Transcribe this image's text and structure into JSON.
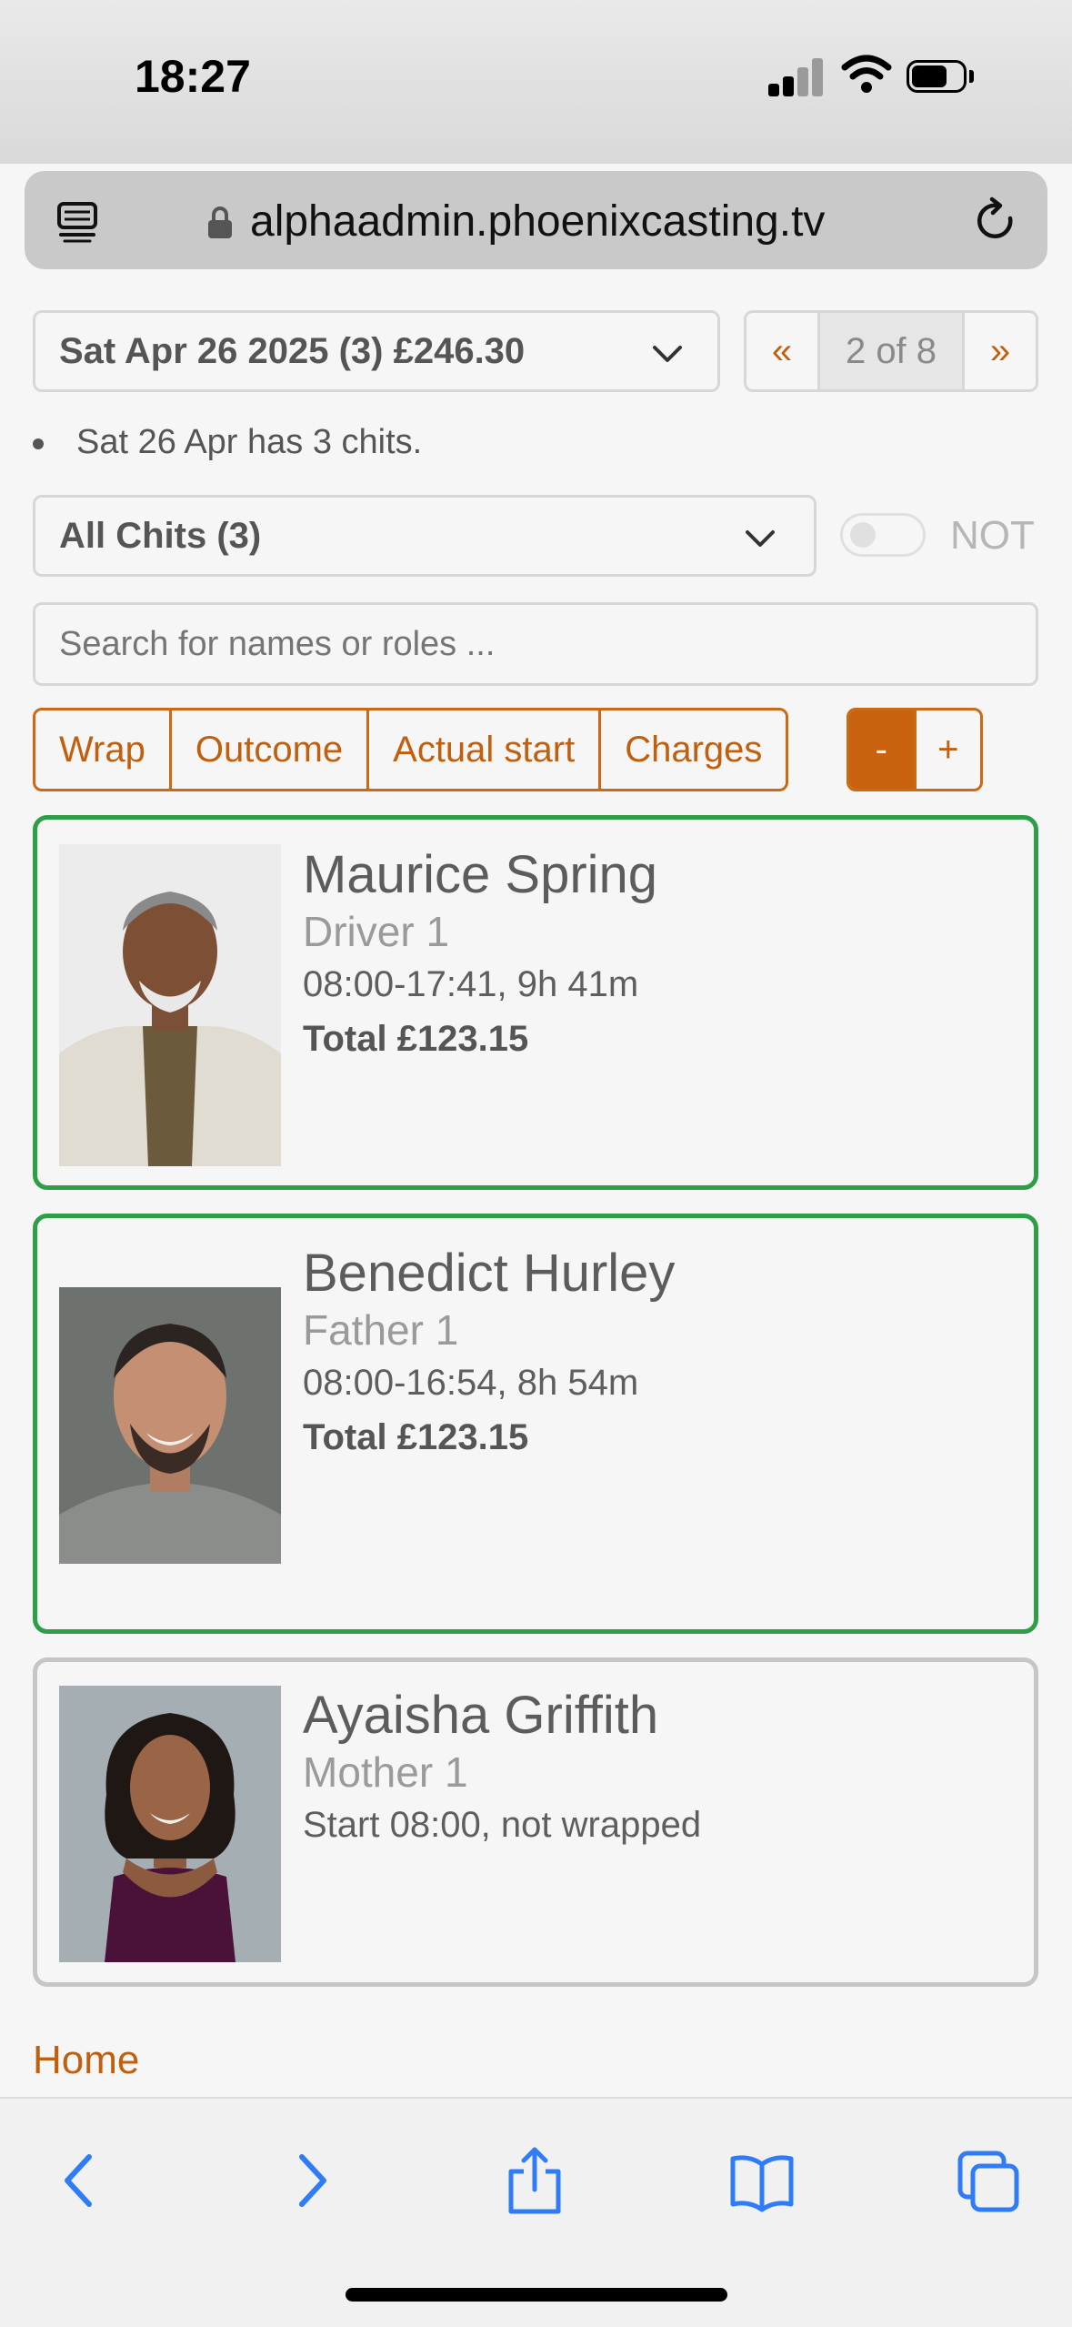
{
  "status": {
    "time": "18:27"
  },
  "browser": {
    "url": "alphaadmin.phoenixcasting.tv"
  },
  "date_select": {
    "value": "Sat Apr 26 2025 (3) £246.30"
  },
  "pager": {
    "prev": "«",
    "count": "2 of 8",
    "next": "»"
  },
  "note": "Sat 26 Apr has 3 chits.",
  "filter": {
    "value": "All Chits (3)",
    "not_label": "NOT"
  },
  "search": {
    "placeholder": "Search for names or roles ..."
  },
  "buttons": {
    "wrap": "Wrap",
    "outcome": "Outcome",
    "actual_start": "Actual start",
    "charges": "Charges"
  },
  "zoom": {
    "minus": "-",
    "plus": "+"
  },
  "cards": [
    {
      "name": "Maurice Spring",
      "role": "Driver 1",
      "time": "08:00-17:41, 9h 41m",
      "total": "Total £123.15",
      "border": "#2e9e47"
    },
    {
      "name": "Benedict Hurley",
      "role": "Father 1",
      "time": "08:00-16:54, 8h 54m",
      "total": "Total £123.15",
      "border": "#2e9e47"
    },
    {
      "name": "Ayaisha Griffith",
      "role": "Mother 1",
      "time": "Start 08:00, not wrapped",
      "border": "#c6c6c6"
    }
  ],
  "footer": {
    "home": "Home"
  },
  "colors": {
    "accent": "#c0600f",
    "complete": "#2e9e47",
    "ios_blue": "#2f7cf6"
  }
}
